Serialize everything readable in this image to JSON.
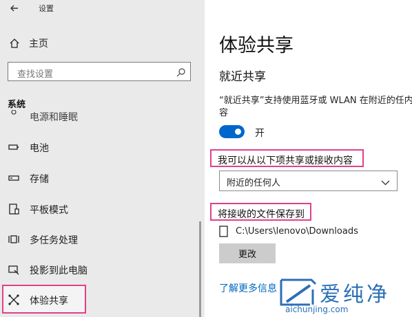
{
  "window": {
    "title": "设置",
    "back_icon": "back-arrow-icon"
  },
  "sidebar": {
    "home_label": "主页",
    "search_placeholder": "查找设置",
    "section_heading": "系统",
    "cutoff_item": "电源和睡眠",
    "items": [
      {
        "label": "电池",
        "icon": "battery-icon"
      },
      {
        "label": "存储",
        "icon": "storage-icon"
      },
      {
        "label": "平板模式",
        "icon": "tablet-icon"
      },
      {
        "label": "多任务处理",
        "icon": "multitasking-icon"
      },
      {
        "label": "投影到此电脑",
        "icon": "project-icon"
      },
      {
        "label": "体验共享",
        "icon": "shared-experiences-icon",
        "active": true
      }
    ]
  },
  "main": {
    "page_title": "体验共享",
    "section_title": "就近共享",
    "description": "“就近共享”支持使用蓝牙或 WLAN 在附近的任内容",
    "toggle": {
      "state": "on",
      "label": "开"
    },
    "share_from_label": "我可以从以下项共享或接收内容",
    "dropdown_value": "附近的任何人",
    "save_to_label": "将接收的文件保存到",
    "save_path": "C:\\Users\\lenovo\\Downloads",
    "change_button": "更改",
    "learn_more_link": "了解更多信息"
  },
  "watermark": {
    "name": "爱纯净",
    "url": "aichunjing.com"
  },
  "colors": {
    "accent": "#0066cc",
    "highlight": "#e0408a",
    "link": "#0067c0"
  }
}
